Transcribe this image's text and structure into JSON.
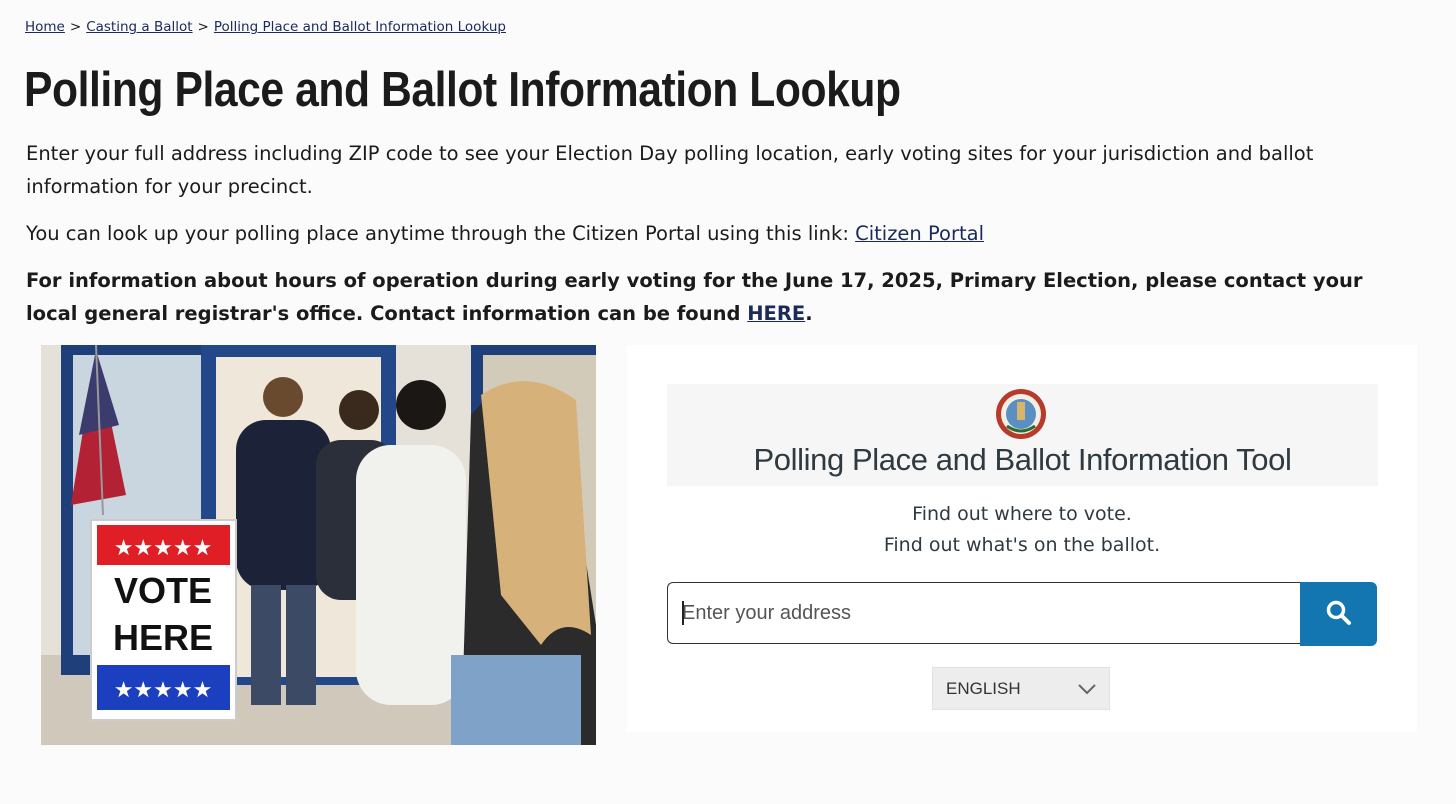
{
  "breadcrumb": {
    "items": [
      "Home",
      "Casting a Ballot",
      "Polling Place and Ballot Information Lookup"
    ],
    "separator": ">"
  },
  "page": {
    "title": "Polling Place and Ballot Information Lookup",
    "intro": "Enter your full address including ZIP code to see your Election Day polling location, early voting sites for your jurisdiction and ballot information for your precinct.",
    "portal_text": "You can look up your polling place anytime through the Citizen Portal using this link: ",
    "portal_link": "Citizen Portal",
    "notice_text": "For information about hours of operation during early voting for the June 17, 2025, Primary Election, please contact your local general registrar's office. Contact information can be found ",
    "notice_link": "HERE",
    "notice_end": "."
  },
  "photo": {
    "sign_line1": "VOTE",
    "sign_line2": "HERE"
  },
  "tool": {
    "title": "Polling Place and Ballot Information Tool",
    "tagline1": "Find out where to vote.",
    "tagline2": "Find out what's on the ballot.",
    "search_placeholder": "Enter your address",
    "search_icon": "search-icon",
    "language": "ENGLISH"
  },
  "colors": {
    "link": "#1a2a5a",
    "button": "#1376b0",
    "text": "#1b1b1b"
  }
}
